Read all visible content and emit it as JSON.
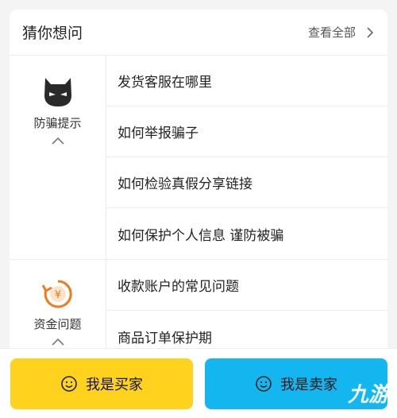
{
  "header": {
    "title": "猜你想问",
    "view_all": "查看全部"
  },
  "sections": [
    {
      "label": "防骗提示",
      "icon": "devil-face-icon",
      "items": [
        "发货客服在哪里",
        "如何举报骗子",
        "如何检验真假分享链接",
        "如何保护个人信息 谨防被骗"
      ]
    },
    {
      "label": "资金问题",
      "icon": "refund-yen-icon",
      "items": [
        "收款账户的常见问题",
        "商品订单保护期"
      ]
    }
  ],
  "bottom": {
    "buyer_label": "我是买家",
    "seller_label": "我是卖家",
    "buyer_color": "#ffd21e",
    "seller_color": "#14b6f0"
  },
  "watermark": "九游"
}
